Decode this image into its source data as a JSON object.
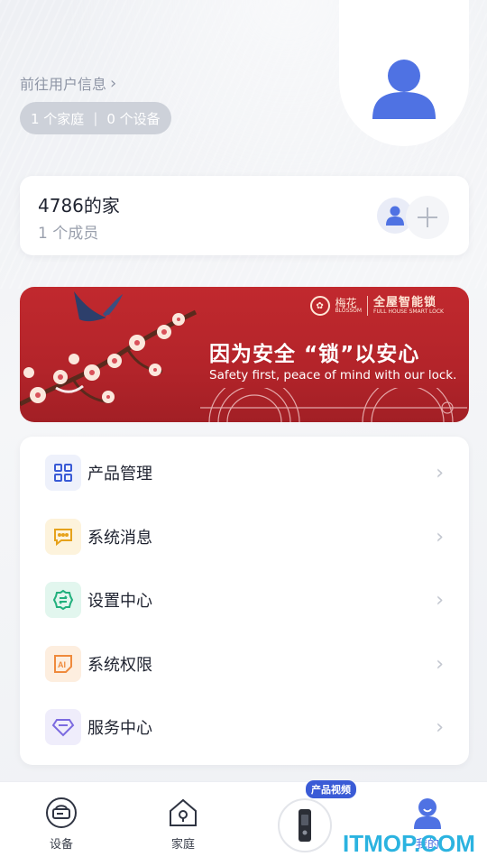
{
  "header": {
    "user_link": "前往用户信息",
    "family_count": "1 个家庭",
    "device_count": "0 个设备"
  },
  "home": {
    "name": "4786的家",
    "members": "1 个成员"
  },
  "banner": {
    "brand_name": "梅花",
    "brand_sub": "BLOSSOM",
    "brand_tag": "全屋智能锁",
    "brand_tag_en": "FULL HOUSE SMART LOCK",
    "slogan_cn": "因为安全 “锁”以安心",
    "slogan_en": "Safety first, peace of mind with our lock."
  },
  "menu": {
    "items": [
      {
        "label": "产品管理",
        "icon": "grid-icon",
        "color": "#3a5bd6",
        "bg": "#eef1fb"
      },
      {
        "label": "系统消息",
        "icon": "message-icon",
        "color": "#e6a21b",
        "bg": "#fdf3dc"
      },
      {
        "label": "设置中心",
        "icon": "settings-icon",
        "color": "#22b07d",
        "bg": "#e2f6ee"
      },
      {
        "label": "系统权限",
        "icon": "ai-icon",
        "color": "#ef8a3c",
        "bg": "#fdeedf"
      },
      {
        "label": "服务中心",
        "icon": "diamond-icon",
        "color": "#7b6ae0",
        "bg": "#efedfb"
      }
    ]
  },
  "tabbar": {
    "tabs": [
      {
        "label": "设备",
        "icon": "device-icon"
      },
      {
        "label": "家庭",
        "icon": "home-icon"
      },
      {
        "label": "我的",
        "icon": "profile-icon"
      }
    ],
    "video_badge": "产品视频"
  },
  "watermark": "ITMOP.COM",
  "colors": {
    "accent": "#3a5bd6",
    "banner_red": "#b3242a",
    "avatar_blue": "#4f72e3"
  }
}
